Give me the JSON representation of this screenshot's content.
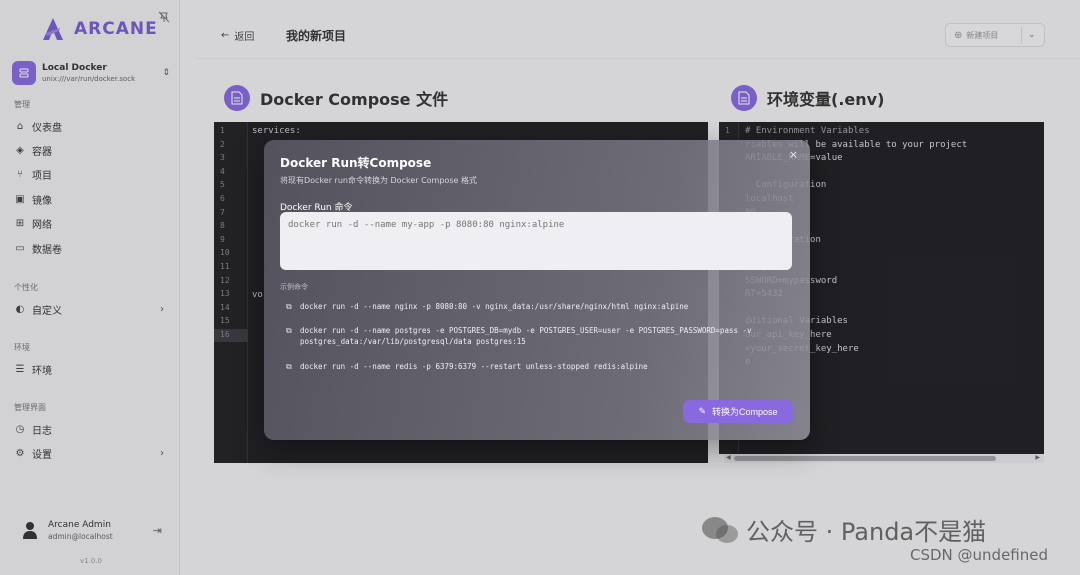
{
  "app": {
    "name": "ARCANE",
    "version": "v1.0.0"
  },
  "environment": {
    "name": "Local Docker",
    "socket": "unix:///var/run/docker.sock"
  },
  "sidebar": {
    "groups": [
      {
        "label": "管理",
        "items": [
          {
            "label": "仪表盘",
            "icon": "home-icon"
          },
          {
            "label": "容器",
            "icon": "box-icon"
          },
          {
            "label": "项目",
            "icon": "project-icon"
          },
          {
            "label": "镜像",
            "icon": "image-icon"
          },
          {
            "label": "网络",
            "icon": "network-icon"
          },
          {
            "label": "数据卷",
            "icon": "drive-icon"
          }
        ]
      },
      {
        "label": "个性化",
        "items": [
          {
            "label": "自定义",
            "icon": "palette-icon",
            "arrow": true
          }
        ]
      },
      {
        "label": "环境",
        "items": [
          {
            "label": "环境",
            "icon": "server-icon"
          }
        ]
      },
      {
        "label": "管理界面",
        "items": [
          {
            "label": "日志",
            "icon": "clock-icon"
          },
          {
            "label": "设置",
            "icon": "gear-icon",
            "arrow": true
          }
        ]
      }
    ]
  },
  "user": {
    "name": "Arcane Admin",
    "email": "admin@localhost"
  },
  "topbar": {
    "back_label": "返回",
    "title": "我的新项目",
    "new_project_label": "新建项目"
  },
  "compose_panel": {
    "title": "Docker Compose 文件",
    "line_numbers": [
      "1",
      "2",
      "3",
      "4",
      "5",
      "6",
      "7",
      "8",
      "9",
      "10",
      "11",
      "12",
      "13",
      "14",
      "15",
      "16"
    ],
    "code_fragments": [
      "services:",
      "vo"
    ]
  },
  "env_panel": {
    "title": "环境变量(.env)",
    "line_numbers": [
      "1"
    ],
    "code_lines": [
      "# Environment Variables",
      "riables will be available to your project",
      "ARIABLE_NAME=value",
      "",
      "  Configuration",
      "localhost",
      "80",
      "",
      " Configuration",
      "=myapp",
      "R=myuser",
      "SSWORD=mypassword",
      "RT=5432",
      "",
      "dditional Variables",
      "our_api_key_here",
      "=your_secret_key_here",
      "e"
    ]
  },
  "dialog": {
    "title": "Docker Run转Compose",
    "description": "将现有Docker run命令转换为 Docker Compose 格式",
    "input_label": "Docker Run 命令",
    "input_placeholder": "docker run -d --name my-app -p 8080:80 nginx:alpine",
    "examples_label": "示例命令",
    "examples": [
      "docker run -d --name nginx -p 8080:80 -v nginx_data:/usr/share/nginx/html nginx:alpine",
      "docker run -d --name postgres -e POSTGRES_DB=mydb -e POSTGRES_USER=user -e POSTGRES_PASSWORD=pass -v postgres_data:/var/lib/postgresql/data postgres:15",
      "docker run -d --name redis -p 6379:6379 --restart unless-stopped redis:alpine"
    ],
    "convert_label": "转换为Compose",
    "close_glyph": "×"
  },
  "watermark": {
    "text": "公众号 · Panda不是猫",
    "text2": "CSDN @undefined"
  },
  "colors": {
    "accent": "#7b5bd6",
    "editor_bg": "#0d0d10"
  }
}
